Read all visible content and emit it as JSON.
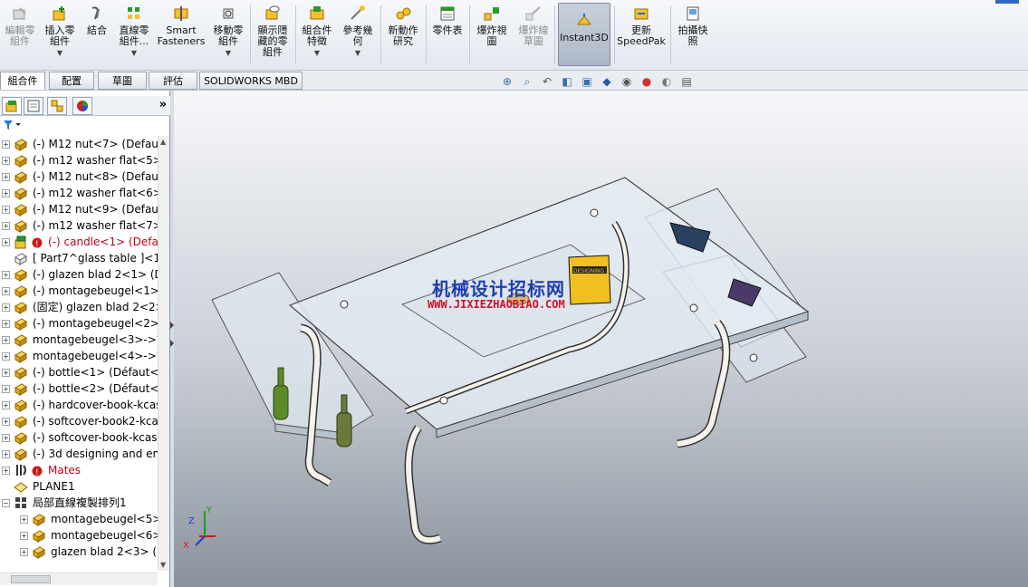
{
  "ribbon": {
    "buttons": [
      {
        "id": "edit-component",
        "label": "編輯零\n組件",
        "icon": "edit-component-icon",
        "disabled": true,
        "arrow": false
      },
      {
        "id": "insert-component",
        "label": "插入零\n組件",
        "icon": "insert-component-icon",
        "disabled": false,
        "arrow": true
      },
      {
        "id": "mate",
        "label": "結合",
        "icon": "mate-icon",
        "disabled": false,
        "arrow": false
      },
      {
        "id": "linear-pattern",
        "label": "直線零\n組件...",
        "icon": "linear-pattern-icon",
        "disabled": false,
        "arrow": true
      },
      {
        "id": "smart-fasteners",
        "label": "Smart\nFasteners",
        "icon": "smart-fasteners-icon",
        "disabled": false,
        "arrow": false
      },
      {
        "id": "move-component",
        "label": "移動零\n組件",
        "icon": "move-component-icon",
        "disabled": false,
        "arrow": true
      },
      {
        "id": "show-hidden",
        "label": "顯示隱\n藏的零\n組件",
        "icon": "show-hidden-icon",
        "disabled": false,
        "arrow": false
      },
      {
        "id": "assembly-feature",
        "label": "組合件\n特徵",
        "icon": "assembly-feature-icon",
        "disabled": false,
        "arrow": true
      },
      {
        "id": "reference-geometry",
        "label": "參考幾\n何",
        "icon": "reference-geometry-icon",
        "disabled": false,
        "arrow": true
      },
      {
        "id": "new-motion-study",
        "label": "新動作\n研究",
        "icon": "motion-study-icon",
        "disabled": false,
        "arrow": false
      },
      {
        "id": "bill-of-materials",
        "label": "零件表",
        "icon": "bom-icon",
        "disabled": false,
        "arrow": false
      },
      {
        "id": "exploded-view",
        "label": "爆炸視\n圖",
        "icon": "exploded-view-icon",
        "disabled": false,
        "arrow": false
      },
      {
        "id": "explode-line-sketch",
        "label": "爆炸線\n草圖",
        "icon": "explode-line-icon",
        "disabled": true,
        "arrow": false
      },
      {
        "id": "instant3d",
        "label": "Instant3D",
        "icon": "instant3d-icon",
        "disabled": false,
        "arrow": false
      },
      {
        "id": "update-speedpak",
        "label": "更新\nSpeedPak",
        "icon": "speedpak-icon",
        "disabled": false,
        "arrow": false
      },
      {
        "id": "take-snapshot",
        "label": "拍攝快\n照",
        "icon": "snapshot-icon",
        "disabled": false,
        "arrow": false
      }
    ]
  },
  "tabs": [
    "組合件",
    "配置",
    "草圖",
    "評估",
    "SOLIDWORKS MBD"
  ],
  "active_tab": "組合件",
  "panel": {
    "tab_icons": [
      "feature-manager-icon",
      "property-manager-icon",
      "configuration-manager-icon",
      "display-manager-icon"
    ],
    "more_label": "»",
    "filter_icon": "filter-icon"
  },
  "tree": [
    {
      "text": "(-) M12 nut<7> (Default",
      "icon": "part-icon",
      "expand": "+",
      "red": false,
      "warn": false
    },
    {
      "text": "(-) m12 washer flat<5> (",
      "icon": "part-icon",
      "expand": "+",
      "red": false,
      "warn": false
    },
    {
      "text": "(-) M12 nut<8> (Default",
      "icon": "part-icon",
      "expand": "+",
      "red": false,
      "warn": false
    },
    {
      "text": "(-) m12 washer flat<6> (",
      "icon": "part-icon",
      "expand": "+",
      "red": false,
      "warn": false
    },
    {
      "text": "(-) M12 nut<9> (Default",
      "icon": "part-icon",
      "expand": "+",
      "red": false,
      "warn": false
    },
    {
      "text": "(-) m12 washer flat<7> (",
      "icon": "part-icon",
      "expand": "+",
      "red": false,
      "warn": false
    },
    {
      "text": "(-) candle<1> (Defau",
      "icon": "assembly-icon",
      "expand": "+",
      "red": true,
      "warn": true
    },
    {
      "text": "[ Part7^glass table ]<1>",
      "icon": "virtual-part-icon",
      "expand": "",
      "red": false,
      "warn": false
    },
    {
      "text": "(-) glazen blad 2<1> (D",
      "icon": "part-icon",
      "expand": "+",
      "red": false,
      "warn": false
    },
    {
      "text": "(-) montagebeugel<1>-",
      "icon": "part-icon",
      "expand": "+",
      "red": false,
      "warn": false
    },
    {
      "text": "(固定) glazen blad 2<2>",
      "icon": "part-icon",
      "expand": "+",
      "red": false,
      "warn": false
    },
    {
      "text": "(-) montagebeugel<2>-",
      "icon": "part-icon",
      "expand": "+",
      "red": false,
      "warn": false
    },
    {
      "text": "montagebeugel<3>->?",
      "icon": "part-icon",
      "expand": "+",
      "red": false,
      "warn": false
    },
    {
      "text": "montagebeugel<4>->?",
      "icon": "part-icon",
      "expand": "+",
      "red": false,
      "warn": false
    },
    {
      "text": "(-) bottle<1> (Défaut<<",
      "icon": "part-icon",
      "expand": "+",
      "red": false,
      "warn": false
    },
    {
      "text": "(-) bottle<2> (Défaut<<",
      "icon": "part-icon",
      "expand": "+",
      "red": false,
      "warn": false
    },
    {
      "text": "(-) hardcover-book-kcas",
      "icon": "part-icon",
      "expand": "+",
      "red": false,
      "warn": false
    },
    {
      "text": "(-) softcover-book2-kca",
      "icon": "part-icon",
      "expand": "+",
      "red": false,
      "warn": false
    },
    {
      "text": "(-) softcover-book-kcas",
      "icon": "part-icon",
      "expand": "+",
      "red": false,
      "warn": false
    },
    {
      "text": "(-) 3d designing and eng",
      "icon": "part-icon",
      "expand": "+",
      "red": false,
      "warn": false
    },
    {
      "text": "Mates",
      "icon": "mates-icon",
      "expand": "+",
      "red": true,
      "warn": true
    },
    {
      "text": "PLANE1",
      "icon": "plane-icon",
      "expand": "",
      "red": false,
      "warn": false
    },
    {
      "text": "局部直線複製排列1",
      "icon": "local-pattern-icon",
      "expand": "-",
      "red": false,
      "warn": false
    },
    {
      "text": "montagebeugel<5>",
      "icon": "part-icon",
      "expand": "+",
      "red": false,
      "warn": false,
      "indent": true
    },
    {
      "text": "montagebeugel<6>",
      "icon": "part-icon",
      "expand": "+",
      "red": false,
      "warn": false,
      "indent": true
    },
    {
      "text": "glazen blad 2<3> (D",
      "icon": "part-icon",
      "expand": "+",
      "red": false,
      "warn": false,
      "indent": true
    }
  ],
  "viewport": {
    "heads_up_icons": [
      "zoom-to-fit-icon",
      "zoom-to-area-icon",
      "previous-view-icon",
      "section-view-icon",
      "view-orientation-icon",
      "display-style-icon",
      "hide-show-items-icon",
      "edit-appearance-icon",
      "apply-scene-icon",
      "view-settings-icon"
    ],
    "watermark_cn": "机械设计招标网",
    "watermark_url": "WWW.JIXIEZHAOBIAO.COM",
    "triad": {
      "x": "X",
      "y": "Y",
      "z": "Z"
    },
    "book_title": "DESIGNING",
    "colors": {
      "x_axis": "#d01818",
      "y_axis": "#18a018",
      "z_axis": "#1840d0",
      "glass": "#dfe6ee",
      "frame": "#f4f2ea",
      "bottle": "#5a8a2a"
    }
  }
}
